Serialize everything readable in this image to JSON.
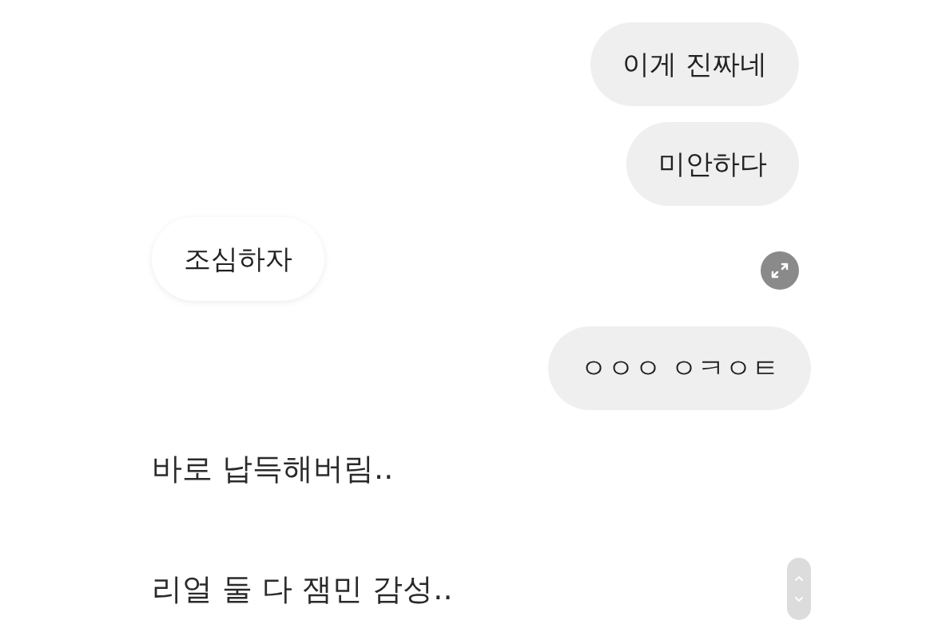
{
  "messages": [
    {
      "kind": "sent",
      "text": "이게 진짜네"
    },
    {
      "kind": "sent",
      "text": "미안하다"
    },
    {
      "kind": "received",
      "text": "조심하자",
      "expand_button": true
    },
    {
      "kind": "sent",
      "text": "ㅇㅇㅇ ㅇㅋㅇㅌ"
    }
  ],
  "captions": [
    {
      "text": "바로 납득해버림..",
      "scroll_handle": false
    },
    {
      "text": "리얼 둘 다 잼민 감성..",
      "scroll_handle": true
    }
  ]
}
